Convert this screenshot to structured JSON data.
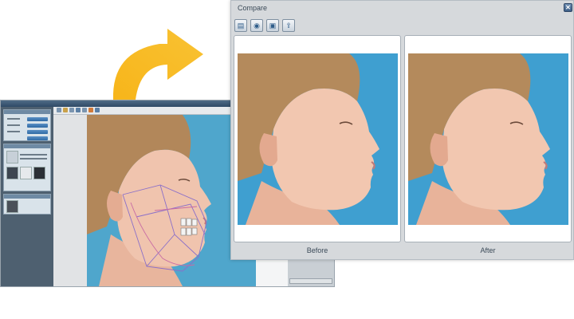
{
  "compare": {
    "title": "Compare",
    "close_glyph": "✕",
    "toolbar": [
      {
        "icon": "scanner-icon"
      },
      {
        "icon": "disk-icon"
      },
      {
        "icon": "save-icon"
      },
      {
        "icon": "export-icon"
      }
    ],
    "panes": {
      "before_label": "Before",
      "after_label": "After"
    }
  },
  "colors": {
    "arrow": "#f5b21b",
    "photo_background": "#3f9fd0",
    "window_chrome": "#d6d9dc"
  }
}
